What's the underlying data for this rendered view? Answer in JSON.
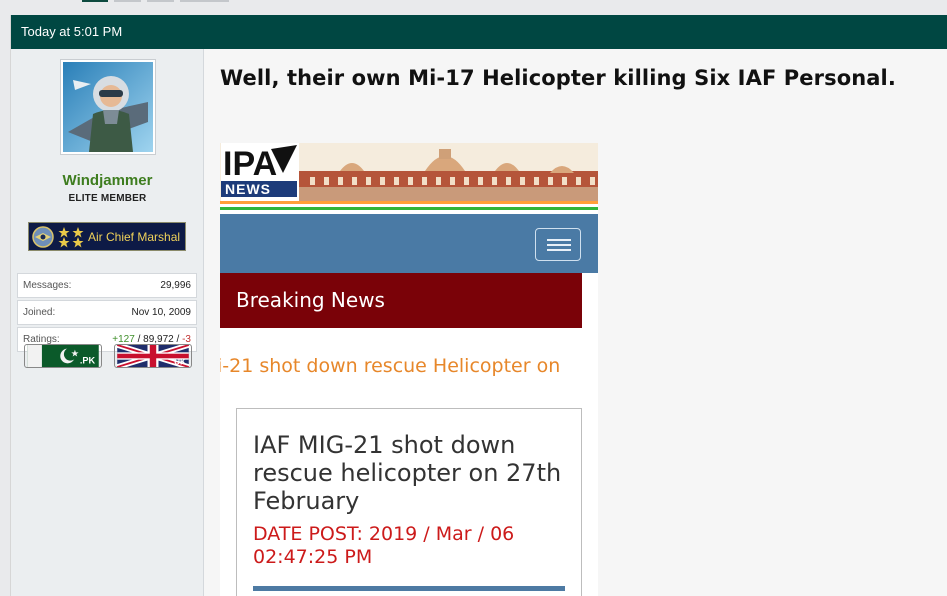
{
  "post": {
    "timestamp": "Today at 5:01 PM",
    "title": "Well, their own Mi-17 Helicopter killing Six IAF Personal."
  },
  "user": {
    "avatar_icon": "pilot-avatar-icon",
    "name": "Windjammer",
    "title": "ELITE MEMBER",
    "rank_label": "Air Chief Marshal",
    "stats": {
      "messages_label": "Messages:",
      "messages_value": "29,996",
      "joined_label": "Joined:",
      "joined_value": "Nov 10, 2009",
      "ratings_label": "Ratings:",
      "ratings_positive": "+127",
      "ratings_separator1": " / ",
      "ratings_total": "89,972",
      "ratings_separator2": " / ",
      "ratings_negative": "-3"
    },
    "flags": [
      {
        "icon": "pakistan-flag-icon",
        "label": ".PK"
      },
      {
        "icon": "uk-flag-icon",
        "label": ".UK"
      }
    ]
  },
  "embed": {
    "logo_top": "IPA",
    "logo_bottom": "NEWS",
    "section_label": "Breaking News",
    "ticker_text": "i-21 shot down rescue Helicopter on",
    "headline": "IAF MIG-21 shot down rescue helicopter on 27th February",
    "date_line": "DATE POST: 2019 / Mar / 06 02:47:25 PM"
  },
  "colors": {
    "header_bg": "#004742",
    "username": "#3e7d1f",
    "breaking_bg": "#7a0208",
    "nav_bg": "#4a7aa5",
    "ticker": "#e7872a",
    "date": "#cc1a1a"
  }
}
